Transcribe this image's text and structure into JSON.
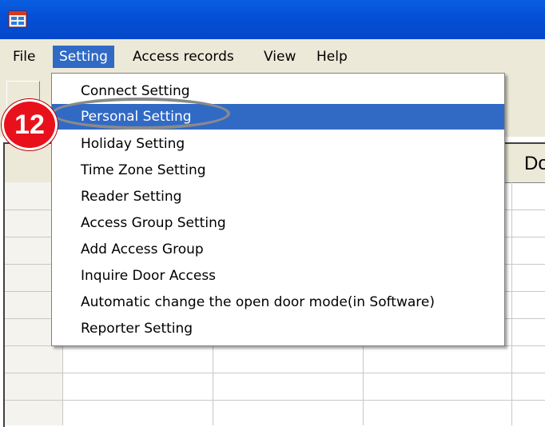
{
  "menubar": {
    "items": [
      {
        "label": "File"
      },
      {
        "label": "Setting"
      },
      {
        "label": "Access records"
      },
      {
        "label": "View"
      },
      {
        "label": "Help"
      }
    ],
    "active_index": 1
  },
  "grid": {
    "visible_header_text": "Do"
  },
  "setting_menu": {
    "items": [
      {
        "label": "Connect Setting"
      },
      {
        "label": "Personal Setting"
      },
      {
        "label": "Holiday Setting"
      },
      {
        "label": "Time Zone Setting"
      },
      {
        "label": "Reader Setting"
      },
      {
        "label": "Access Group Setting"
      },
      {
        "label": "Add Access Group"
      },
      {
        "label": "Inquire Door Access"
      },
      {
        "label": "Automatic change the open door mode(in Software)"
      },
      {
        "label": "Reporter Setting"
      }
    ],
    "selected_index": 1
  },
  "annotation": {
    "step_number": "12"
  },
  "colors": {
    "titlebar": "#0550d8",
    "menu_highlight": "#316ac5",
    "badge": "#e8111b"
  }
}
